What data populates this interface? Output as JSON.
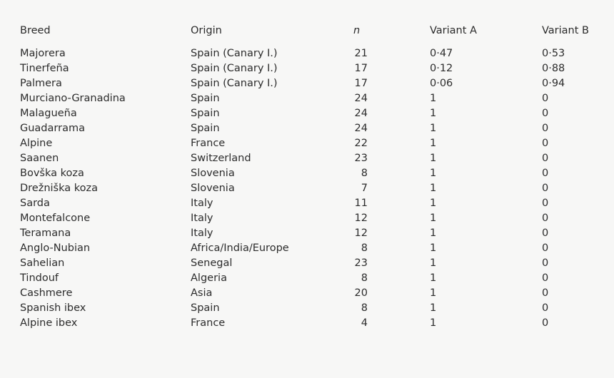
{
  "table": {
    "columns": [
      {
        "key": "breed",
        "label": "Breed",
        "italic": false
      },
      {
        "key": "origin",
        "label": "Origin",
        "italic": false
      },
      {
        "key": "n",
        "label": "n",
        "italic": true
      },
      {
        "key": "variant_a",
        "label": "Variant A",
        "italic": false
      },
      {
        "key": "variant_b",
        "label": "Variant B",
        "italic": false
      }
    ],
    "rows": [
      {
        "breed": "Majorera",
        "origin": "Spain (Canary I.)",
        "n": "21",
        "variant_a": "0·47",
        "variant_b": "0·53"
      },
      {
        "breed": "Tinerfeña",
        "origin": "Spain (Canary I.)",
        "n": "17",
        "variant_a": "0·12",
        "variant_b": "0·88"
      },
      {
        "breed": "Palmera",
        "origin": "Spain (Canary I.)",
        "n": "17",
        "variant_a": "0·06",
        "variant_b": "0·94"
      },
      {
        "breed": "Murciano-Granadina",
        "origin": "Spain",
        "n": "24",
        "variant_a": "1",
        "variant_b": "0"
      },
      {
        "breed": "Malagueña",
        "origin": "Spain",
        "n": "24",
        "variant_a": "1",
        "variant_b": "0"
      },
      {
        "breed": "Guadarrama",
        "origin": "Spain",
        "n": "24",
        "variant_a": "1",
        "variant_b": "0"
      },
      {
        "breed": "Alpine",
        "origin": "France",
        "n": "22",
        "variant_a": "1",
        "variant_b": "0"
      },
      {
        "breed": "Saanen",
        "origin": "Switzerland",
        "n": "23",
        "variant_a": "1",
        "variant_b": "0"
      },
      {
        "breed": "Bovška koza",
        "origin": "Slovenia",
        "n": "8",
        "variant_a": "1",
        "variant_b": "0"
      },
      {
        "breed": "Drežniška koza",
        "origin": "Slovenia",
        "n": "7",
        "variant_a": "1",
        "variant_b": "0"
      },
      {
        "breed": "Sarda",
        "origin": "Italy",
        "n": "11",
        "variant_a": "1",
        "variant_b": "0"
      },
      {
        "breed": "Montefalcone",
        "origin": "Italy",
        "n": "12",
        "variant_a": "1",
        "variant_b": "0"
      },
      {
        "breed": "Teramana",
        "origin": "Italy",
        "n": "12",
        "variant_a": "1",
        "variant_b": "0"
      },
      {
        "breed": "Anglo-Nubian",
        "origin": "Africa/India/Europe",
        "n": "8",
        "variant_a": "1",
        "variant_b": "0"
      },
      {
        "breed": "Sahelian",
        "origin": "Senegal",
        "n": "23",
        "variant_a": "1",
        "variant_b": "0"
      },
      {
        "breed": "Tindouf",
        "origin": "Algeria",
        "n": "8",
        "variant_a": "1",
        "variant_b": "0"
      },
      {
        "breed": "Cashmere",
        "origin": "Asia",
        "n": "20",
        "variant_a": "1",
        "variant_b": "0"
      },
      {
        "breed": "Spanish ibex",
        "origin": "Spain",
        "n": "8",
        "variant_a": "1",
        "variant_b": "0"
      },
      {
        "breed": "Alpine ibex",
        "origin": "France",
        "n": "4",
        "variant_a": "1",
        "variant_b": "0"
      }
    ]
  },
  "style": {
    "background": "#f7f7f6",
    "text_color": "#2b2b2b"
  }
}
